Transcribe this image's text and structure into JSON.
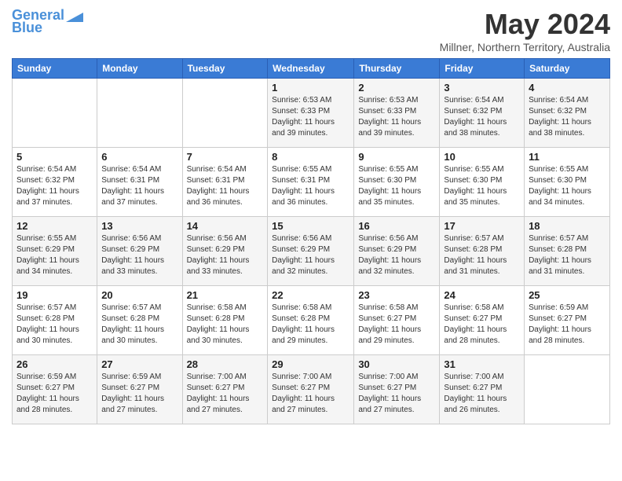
{
  "header": {
    "logo_line1": "General",
    "logo_line2": "Blue",
    "month_title": "May 2024",
    "subtitle": "Millner, Northern Territory, Australia"
  },
  "weekdays": [
    "Sunday",
    "Monday",
    "Tuesday",
    "Wednesday",
    "Thursday",
    "Friday",
    "Saturday"
  ],
  "weeks": [
    [
      {
        "day": "",
        "info": ""
      },
      {
        "day": "",
        "info": ""
      },
      {
        "day": "",
        "info": ""
      },
      {
        "day": "1",
        "info": "Sunrise: 6:53 AM\nSunset: 6:33 PM\nDaylight: 11 hours\nand 39 minutes."
      },
      {
        "day": "2",
        "info": "Sunrise: 6:53 AM\nSunset: 6:33 PM\nDaylight: 11 hours\nand 39 minutes."
      },
      {
        "day": "3",
        "info": "Sunrise: 6:54 AM\nSunset: 6:32 PM\nDaylight: 11 hours\nand 38 minutes."
      },
      {
        "day": "4",
        "info": "Sunrise: 6:54 AM\nSunset: 6:32 PM\nDaylight: 11 hours\nand 38 minutes."
      }
    ],
    [
      {
        "day": "5",
        "info": "Sunrise: 6:54 AM\nSunset: 6:32 PM\nDaylight: 11 hours\nand 37 minutes."
      },
      {
        "day": "6",
        "info": "Sunrise: 6:54 AM\nSunset: 6:31 PM\nDaylight: 11 hours\nand 37 minutes."
      },
      {
        "day": "7",
        "info": "Sunrise: 6:54 AM\nSunset: 6:31 PM\nDaylight: 11 hours\nand 36 minutes."
      },
      {
        "day": "8",
        "info": "Sunrise: 6:55 AM\nSunset: 6:31 PM\nDaylight: 11 hours\nand 36 minutes."
      },
      {
        "day": "9",
        "info": "Sunrise: 6:55 AM\nSunset: 6:30 PM\nDaylight: 11 hours\nand 35 minutes."
      },
      {
        "day": "10",
        "info": "Sunrise: 6:55 AM\nSunset: 6:30 PM\nDaylight: 11 hours\nand 35 minutes."
      },
      {
        "day": "11",
        "info": "Sunrise: 6:55 AM\nSunset: 6:30 PM\nDaylight: 11 hours\nand 34 minutes."
      }
    ],
    [
      {
        "day": "12",
        "info": "Sunrise: 6:55 AM\nSunset: 6:29 PM\nDaylight: 11 hours\nand 34 minutes."
      },
      {
        "day": "13",
        "info": "Sunrise: 6:56 AM\nSunset: 6:29 PM\nDaylight: 11 hours\nand 33 minutes."
      },
      {
        "day": "14",
        "info": "Sunrise: 6:56 AM\nSunset: 6:29 PM\nDaylight: 11 hours\nand 33 minutes."
      },
      {
        "day": "15",
        "info": "Sunrise: 6:56 AM\nSunset: 6:29 PM\nDaylight: 11 hours\nand 32 minutes."
      },
      {
        "day": "16",
        "info": "Sunrise: 6:56 AM\nSunset: 6:29 PM\nDaylight: 11 hours\nand 32 minutes."
      },
      {
        "day": "17",
        "info": "Sunrise: 6:57 AM\nSunset: 6:28 PM\nDaylight: 11 hours\nand 31 minutes."
      },
      {
        "day": "18",
        "info": "Sunrise: 6:57 AM\nSunset: 6:28 PM\nDaylight: 11 hours\nand 31 minutes."
      }
    ],
    [
      {
        "day": "19",
        "info": "Sunrise: 6:57 AM\nSunset: 6:28 PM\nDaylight: 11 hours\nand 30 minutes."
      },
      {
        "day": "20",
        "info": "Sunrise: 6:57 AM\nSunset: 6:28 PM\nDaylight: 11 hours\nand 30 minutes."
      },
      {
        "day": "21",
        "info": "Sunrise: 6:58 AM\nSunset: 6:28 PM\nDaylight: 11 hours\nand 30 minutes."
      },
      {
        "day": "22",
        "info": "Sunrise: 6:58 AM\nSunset: 6:28 PM\nDaylight: 11 hours\nand 29 minutes."
      },
      {
        "day": "23",
        "info": "Sunrise: 6:58 AM\nSunset: 6:27 PM\nDaylight: 11 hours\nand 29 minutes."
      },
      {
        "day": "24",
        "info": "Sunrise: 6:58 AM\nSunset: 6:27 PM\nDaylight: 11 hours\nand 28 minutes."
      },
      {
        "day": "25",
        "info": "Sunrise: 6:59 AM\nSunset: 6:27 PM\nDaylight: 11 hours\nand 28 minutes."
      }
    ],
    [
      {
        "day": "26",
        "info": "Sunrise: 6:59 AM\nSunset: 6:27 PM\nDaylight: 11 hours\nand 28 minutes."
      },
      {
        "day": "27",
        "info": "Sunrise: 6:59 AM\nSunset: 6:27 PM\nDaylight: 11 hours\nand 27 minutes."
      },
      {
        "day": "28",
        "info": "Sunrise: 7:00 AM\nSunset: 6:27 PM\nDaylight: 11 hours\nand 27 minutes."
      },
      {
        "day": "29",
        "info": "Sunrise: 7:00 AM\nSunset: 6:27 PM\nDaylight: 11 hours\nand 27 minutes."
      },
      {
        "day": "30",
        "info": "Sunrise: 7:00 AM\nSunset: 6:27 PM\nDaylight: 11 hours\nand 27 minutes."
      },
      {
        "day": "31",
        "info": "Sunrise: 7:00 AM\nSunset: 6:27 PM\nDaylight: 11 hours\nand 26 minutes."
      },
      {
        "day": "",
        "info": ""
      }
    ]
  ]
}
